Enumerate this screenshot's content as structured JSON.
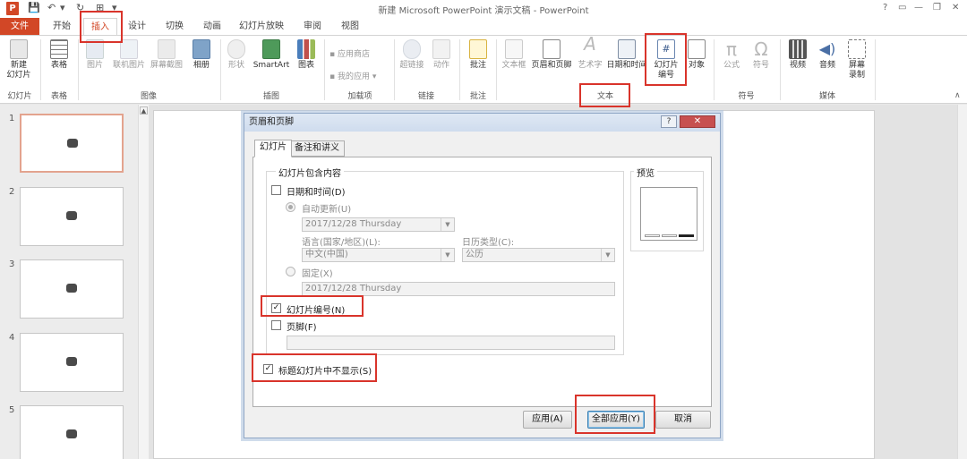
{
  "titlebar": {
    "app_icon": "P",
    "title": "新建 Microsoft PowerPoint 演示文稿 - PowerPoint",
    "qat": [
      "save-icon",
      "undo-icon",
      "redo-icon"
    ],
    "controls": [
      "?",
      "▭",
      "—",
      "❐",
      "✕"
    ]
  },
  "tabs": [
    "文件",
    "开始",
    "插入",
    "设计",
    "切换",
    "动画",
    "幻灯片放映",
    "审阅",
    "视图"
  ],
  "active_tab": "插入",
  "ribbon": {
    "new_slide": "新建\n幻灯片",
    "table": "表格",
    "picture": "图片",
    "online_picture": "联机图片",
    "screenshot": "屏幕截图",
    "album": "相册",
    "shapes": "形状",
    "smartart": "SmartArt",
    "chart": "图表",
    "store": "应用商店",
    "my_apps": "我的应用",
    "hyperlink": "超链接",
    "action": "动作",
    "comment": "批注",
    "textbox": "文本框",
    "header_footer": "页眉和页脚",
    "wordart": "艺术字",
    "datetime": "日期和时间",
    "slide_number": "幻灯片\n编号",
    "object": "对象",
    "equation": "公式",
    "symbol": "符号",
    "video": "视频",
    "audio": "音频",
    "screen_recording": "屏幕\n录制",
    "groups": [
      "幻灯片",
      "表格",
      "图像",
      "插图",
      "加载项",
      "链接",
      "批注",
      "文本",
      "符号",
      "媒体"
    ]
  },
  "thumbnails": [
    "1",
    "2",
    "3",
    "4",
    "5"
  ],
  "dialog": {
    "title": "页眉和页脚",
    "help": "?",
    "close": "✕",
    "tab_slide": "幻灯片",
    "tab_notes": "备注和讲义",
    "group_label": "幻灯片包含内容",
    "datetime_label": "日期和时间(D)",
    "datetime_checked": false,
    "auto_update_label": "自动更新(U)",
    "auto_update_value": "2017/12/28 Thursday",
    "language_label": "语言(国家/地区)(L):",
    "language_value": "中文(中国)",
    "calendar_label": "日历类型(C):",
    "calendar_value": "公历",
    "fixed_label": "固定(X)",
    "fixed_value": "2017/12/28 Thursday",
    "slide_number_label": "幻灯片编号(N)",
    "slide_number_checked": true,
    "footer_label": "页脚(F)",
    "footer_checked": false,
    "footer_value": "",
    "hide_title_label": "标题幻灯片中不显示(S)",
    "hide_title_checked": true,
    "preview_label": "预览",
    "apply": "应用(A)",
    "apply_all": "全部应用(Y)",
    "cancel": "取消"
  },
  "colors": {
    "accent": "#d24726",
    "annotation": "#d9342b"
  }
}
